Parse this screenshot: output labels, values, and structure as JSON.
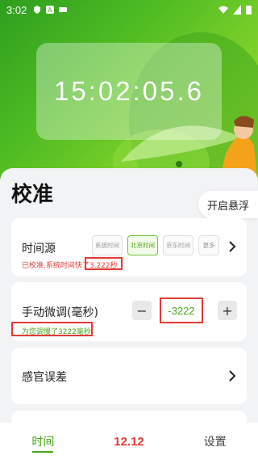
{
  "status_bar": {
    "time": "3:02"
  },
  "clock": {
    "display": "15:02:05.6"
  },
  "page": {
    "title": "校准",
    "float_button": "开启悬浮"
  },
  "time_source": {
    "label": "时间源",
    "tabs": [
      "系统时间",
      "北京时间",
      "京东时间",
      "更多"
    ],
    "selected": "北京时间",
    "hint": "已校准,系统时间快了3.222秒"
  },
  "manual_adjust": {
    "label": "手动微调(毫秒)",
    "minus": "−",
    "plus": "+",
    "value": "-3222",
    "hint": "为您调慢了3222毫秒"
  },
  "sensory_error": {
    "label": "感官误差"
  },
  "tabbar": {
    "tabs": [
      "时间",
      "12.12",
      "设置"
    ],
    "active": "时间"
  },
  "colors": {
    "accent": "#4da51c",
    "warning": "#e53935"
  }
}
